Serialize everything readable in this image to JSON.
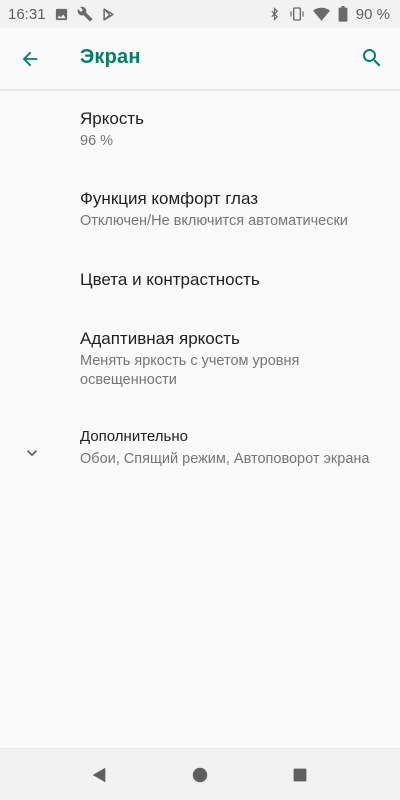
{
  "status_bar": {
    "time": "16:31",
    "battery_text": "90 %",
    "icons_left": [
      "image-icon",
      "wrench-icon",
      "play-store-icon"
    ],
    "icons_right": [
      "bluetooth-icon",
      "vibrate-icon",
      "wifi-icon",
      "battery-icon"
    ]
  },
  "app_bar": {
    "title": "Экран",
    "accent_color": "#00806b",
    "back_icon": "arrow-left-icon",
    "search_icon": "search-icon"
  },
  "settings": {
    "brightness": {
      "title": "Яркость",
      "summary": "96 %"
    },
    "eye_comfort": {
      "title": "Функция комфорт глаз",
      "summary": "Отключен/Не включится автоматически"
    },
    "colors": {
      "title": "Цвета и контрастность"
    },
    "adaptive": {
      "title": "Адаптивная яркость",
      "summary": "Менять яркость с учетом уровня освещенности"
    },
    "advanced": {
      "title": "Дополнительно",
      "summary": "Обои, Спящий режим, Автоповорот экрана",
      "icon": "chevron-down-icon"
    }
  },
  "nav_bar": {
    "back_icon": "nav-back-triangle-icon",
    "home_icon": "nav-home-circle-icon",
    "recents_icon": "nav-recents-square-icon"
  }
}
